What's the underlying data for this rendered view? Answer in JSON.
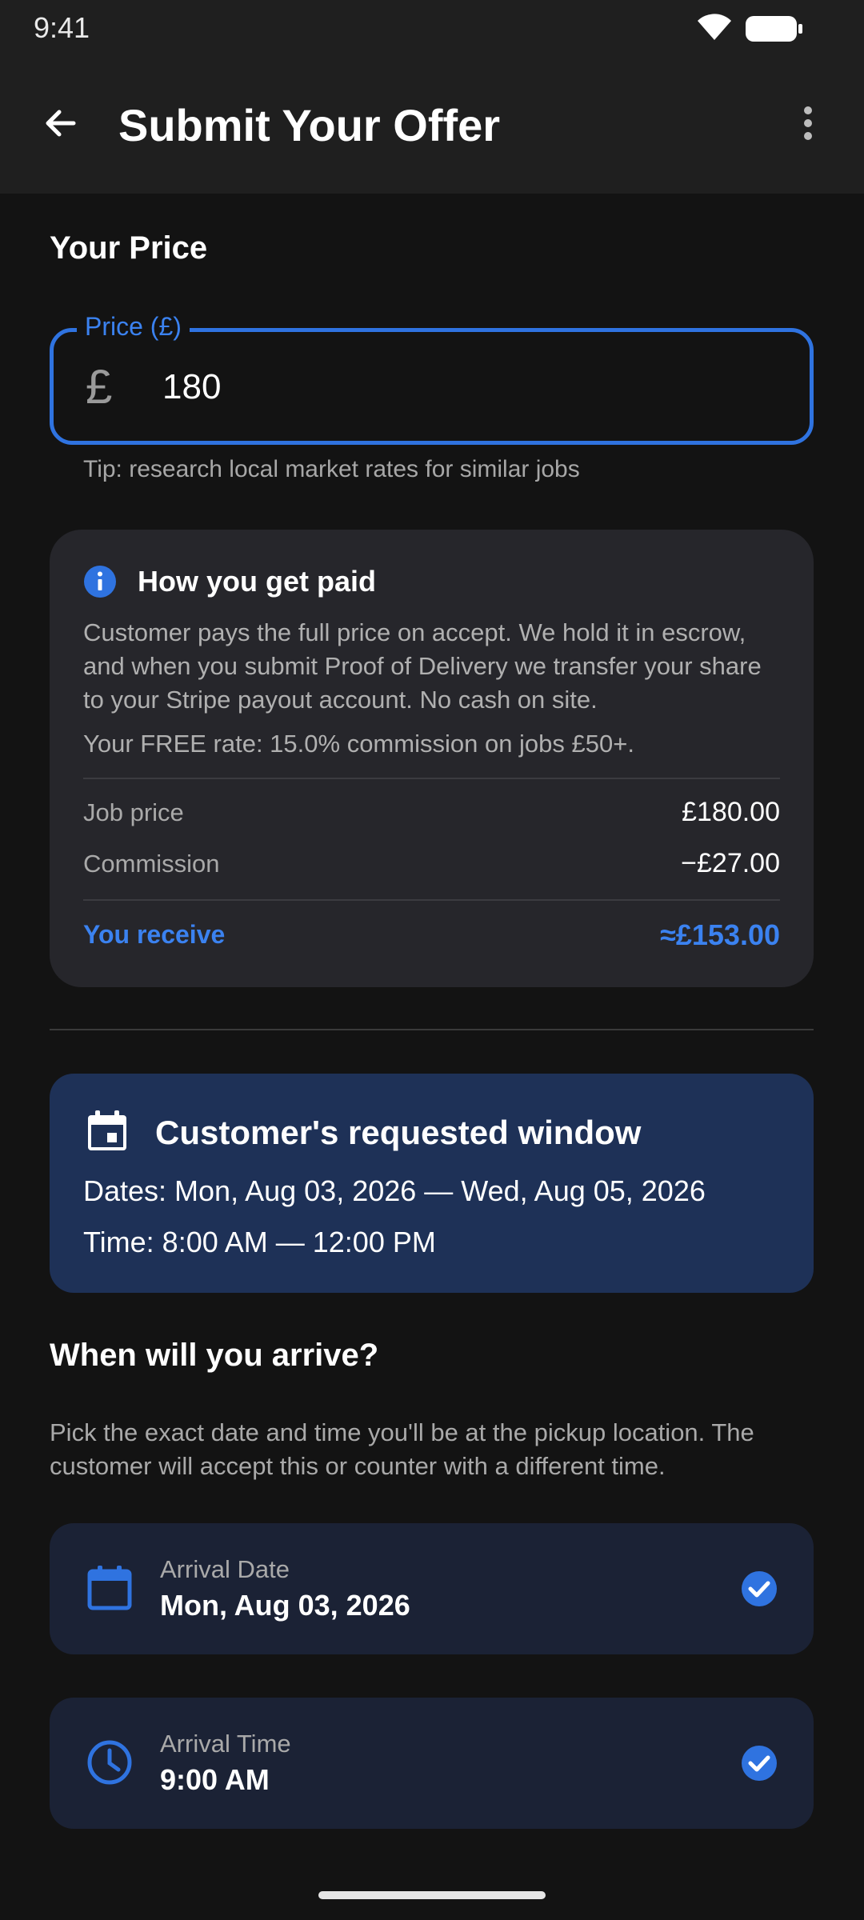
{
  "status_bar": {
    "time": "9:41",
    "icons": [
      "wifi-icon",
      "battery-icon"
    ]
  },
  "app_bar": {
    "title": "Submit Your Offer",
    "back_icon": "arrow-left-icon",
    "menu_icon": "more-vertical-icon"
  },
  "price_section": {
    "title": "Your Price",
    "field_label": "Price (£)",
    "currency_symbol": "£",
    "value": "180",
    "tip": "Tip: research local market rates for similar jobs"
  },
  "payment_info": {
    "title": "How you get paid",
    "description": "Customer pays the full price on accept. We hold it in escrow, and when you submit Proof of Delivery we transfer your share to your Stripe payout account. No cash on site.",
    "rate": "Your FREE rate: 15.0% commission on jobs £50+.",
    "job_price_label": "Job price",
    "job_price_value": "£180.00",
    "commission_label": "Commission",
    "commission_value": "−£27.00",
    "receive_label": "You receive",
    "receive_value": "≈£153.00"
  },
  "requested_window": {
    "title": "Customer's requested window",
    "dates": "Dates: Mon, Aug 03, 2026 — Wed, Aug 05, 2026",
    "time": "Time: 8:00 AM — 12:00 PM"
  },
  "arrival": {
    "title": "When will you arrive?",
    "description": "Pick the exact date and time you'll be at the pickup location. The customer will accept this or counter with a different time.",
    "date_label": "Arrival Date",
    "date_value": "Mon, Aug 03, 2026",
    "time_label": "Arrival Time",
    "time_value": "9:00 AM"
  },
  "colors": {
    "accent": "#2f73e0",
    "background": "#131313",
    "app_bar": "#1f1f1f",
    "card": "#26262b",
    "window_card": "#1e3157",
    "pick_card": "#1b2235"
  }
}
